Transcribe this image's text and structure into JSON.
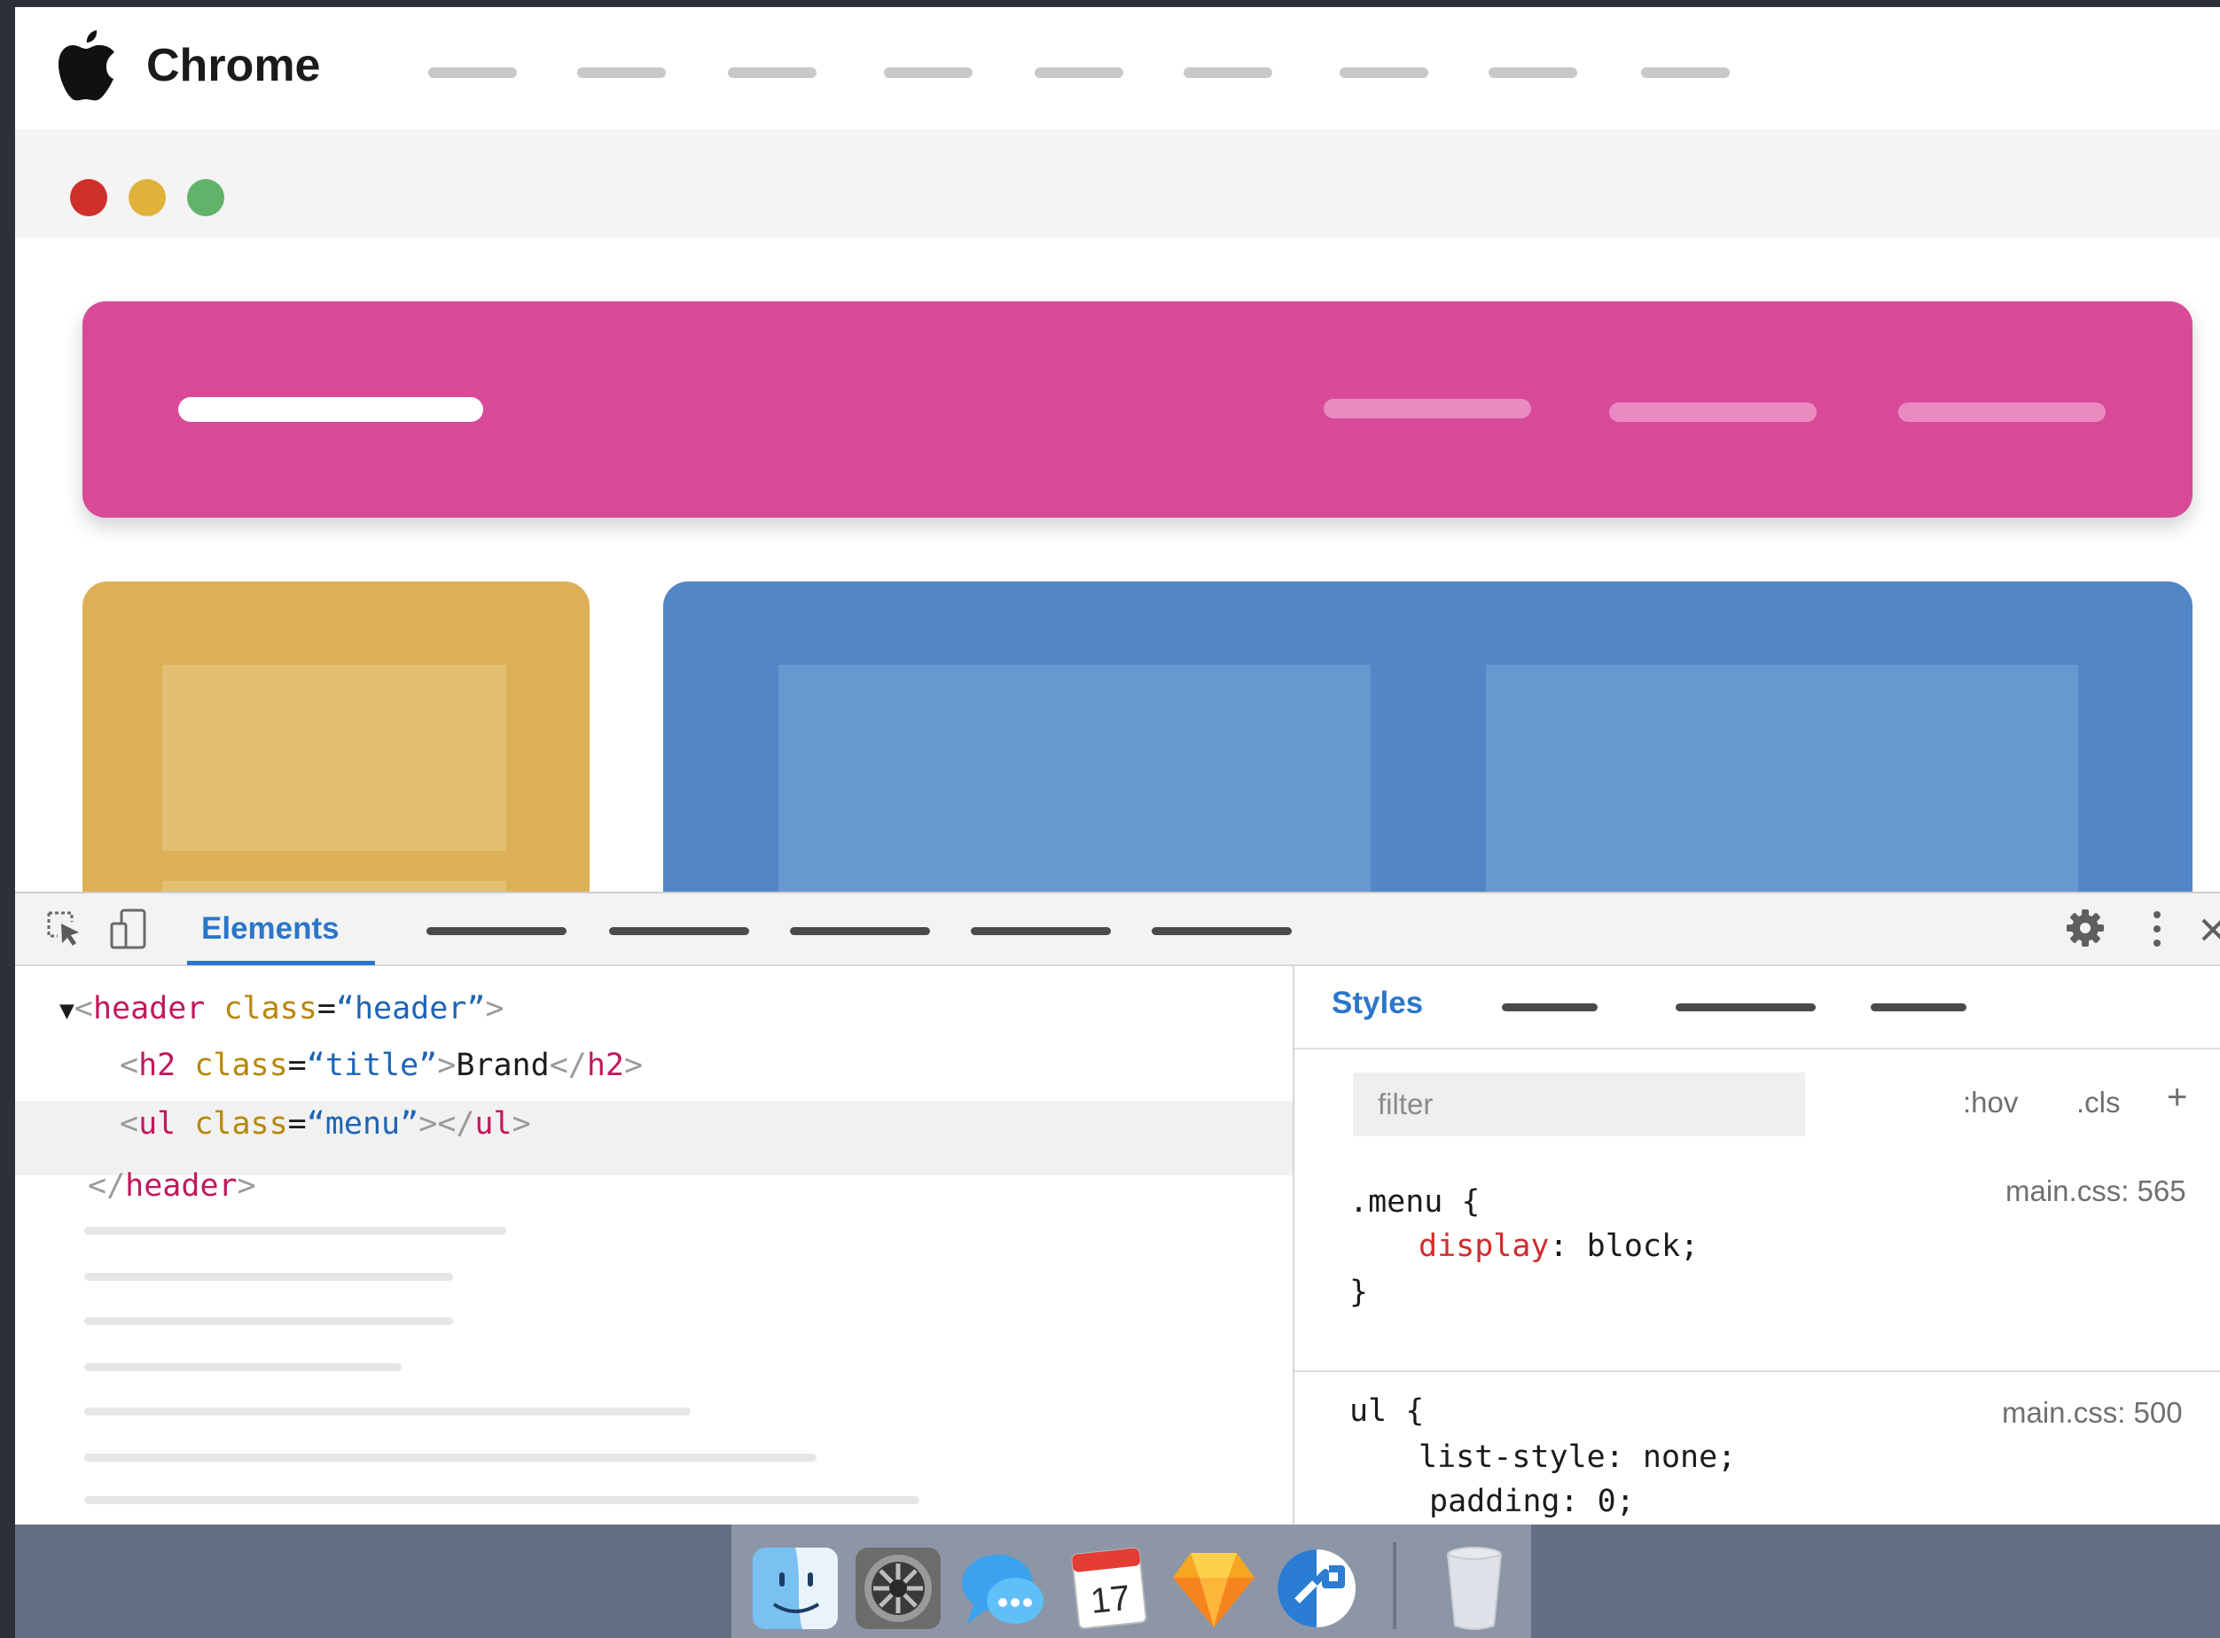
{
  "menubar": {
    "app_name": "Chrome",
    "menu_items_count_hint": ""
  },
  "window": {
    "traffic_lights": {
      "close": "#d0302a",
      "minimize": "#e0b23a",
      "zoom": "#61b36a"
    }
  },
  "page": {
    "colors": {
      "hero": "#d84a98",
      "card_yellow": "#ddb057",
      "card_blue": "#5286c6"
    }
  },
  "devtools": {
    "tabs": {
      "active": "Elements"
    },
    "elements": {
      "lines": [
        {
          "arrow": "▼",
          "open": "<",
          "tag": "header",
          "attr": "class",
          "eq": "=",
          "val": "“header”",
          "close": ">"
        },
        {
          "open": "<",
          "tag": "h2",
          "attr": "class",
          "eq": "=",
          "val": "“title”",
          "gt": ">",
          "text": "Brand",
          "end_open": "</",
          "end_tag": "h2",
          "end_close": ">"
        },
        {
          "open": "<",
          "tag": "ul",
          "attr": "class",
          "eq": "=",
          "val": "“menu”",
          "gt": ">",
          "end_open": "</",
          "end_tag": "ul",
          "end_close": ">"
        },
        {
          "open": "</",
          "tag": "header",
          "close": ">"
        }
      ]
    },
    "styles": {
      "tab_label": "Styles",
      "filter_placeholder": "filter",
      "hov": ":hov",
      "cls": ".cls",
      "plus": "+",
      "rules": [
        {
          "selector": ".menu {",
          "source": "main.css: 565",
          "decls": [
            {
              "prop": "display",
              "sep": ": ",
              "value": "block;"
            }
          ],
          "end": "}"
        },
        {
          "selector": "ul {",
          "source": "main.css: 500",
          "decls": [
            {
              "prop": "list-style",
              "sep": ": ",
              "value": "none;"
            },
            {
              "prop": "padding",
              "sep": ": ",
              "value": "0;"
            }
          ]
        }
      ]
    }
  },
  "dock": {
    "apps": [
      "finder-icon",
      "system-preferences-icon",
      "messages-icon",
      "calendar-icon",
      "sketch-icon",
      "migration-icon",
      "trash-icon"
    ],
    "calendar_day": "17"
  }
}
